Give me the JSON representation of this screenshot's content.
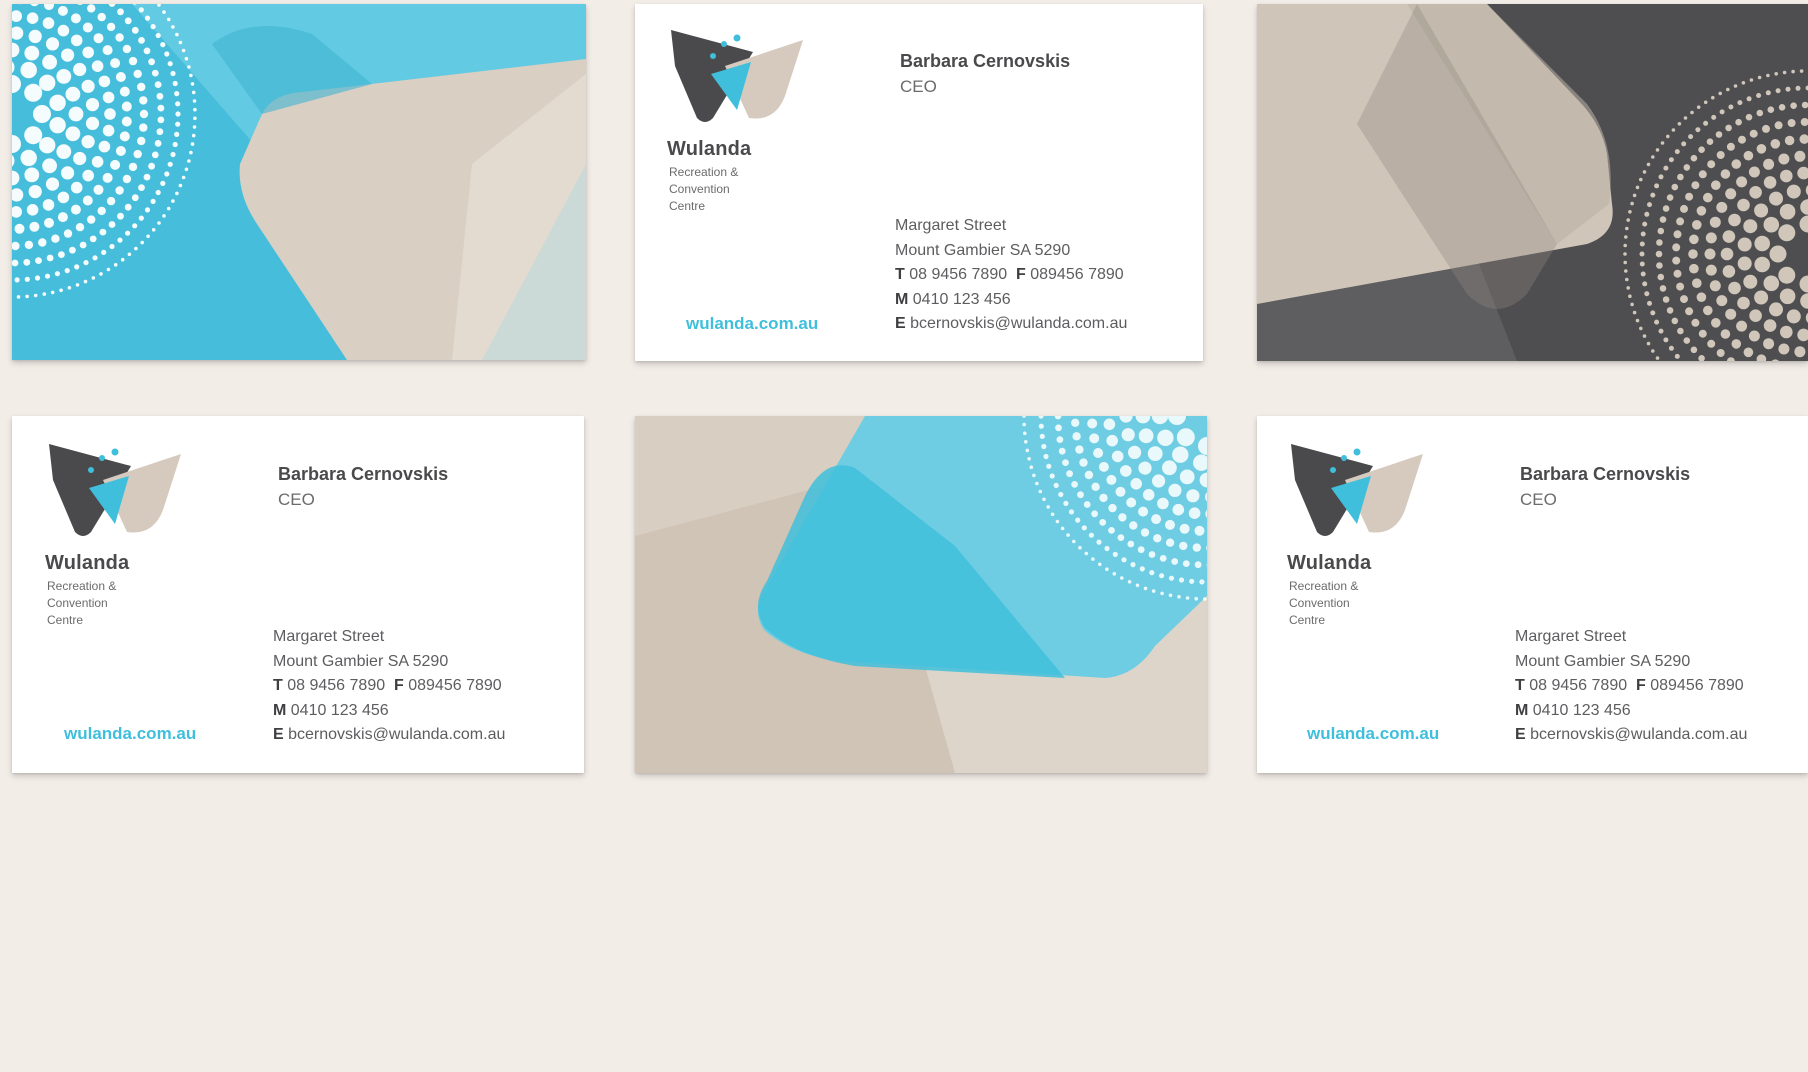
{
  "brand": {
    "name": "Wulanda",
    "subtitle_lines": [
      "Recreation &",
      "Convention",
      "Centre"
    ],
    "website": "wulanda.com.au"
  },
  "person": {
    "name": "Barbara Cernovskis",
    "title": "CEO"
  },
  "contact": {
    "address_line1": "Margaret Street",
    "address_line2": "Mount Gambier SA 5290",
    "phone_prefix": "T",
    "phone": "08 9456 7890",
    "fax_prefix": "F",
    "fax": "089456 7890",
    "mobile_prefix": "M",
    "mobile": "0410 123 456",
    "email_prefix": "E",
    "email": "bcernovskis@wulanda.com.au"
  },
  "colors": {
    "background": "#f3ede8",
    "brand_blue": "#3fbfdc",
    "brand_light_blue": "#6ecde3",
    "brand_sand": "#d5cabd",
    "brand_charcoal": "#4a4a4c",
    "brand_grey": "#6b6b6d"
  },
  "icons": {
    "logo": "wulanda-butterfly-logo-icon",
    "dot_pattern": "concentric-dot-circle-pattern"
  }
}
